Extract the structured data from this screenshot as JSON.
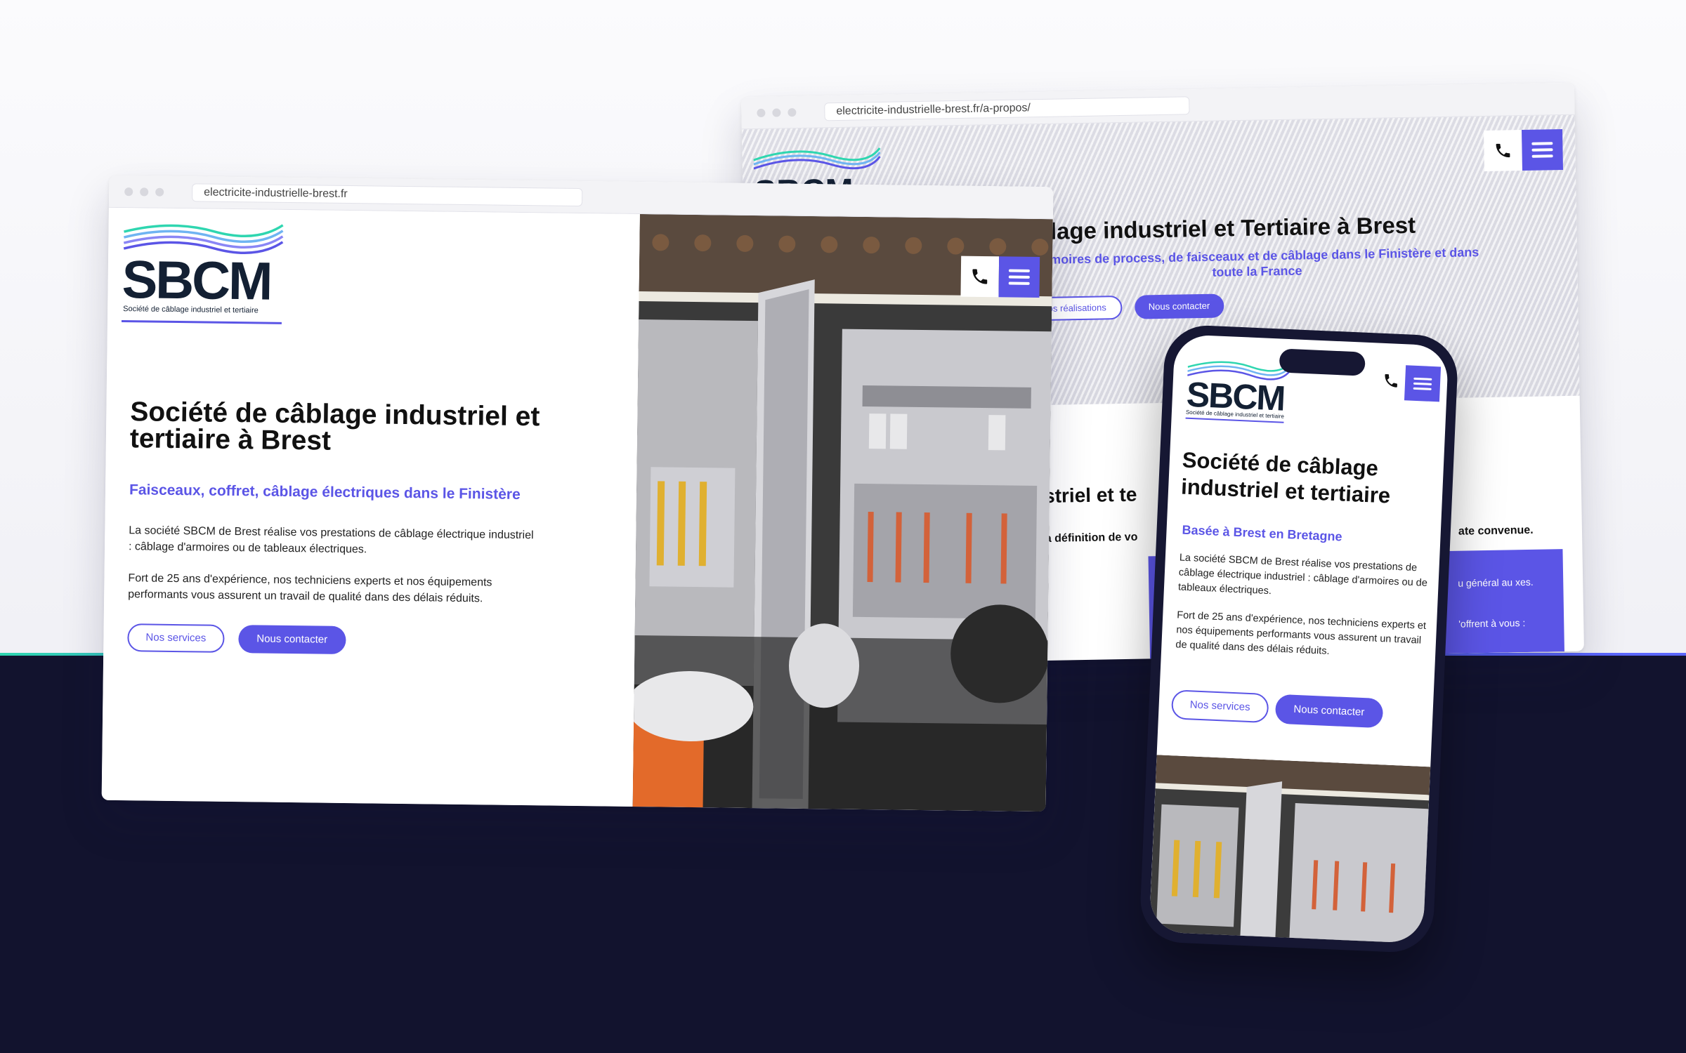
{
  "brand": {
    "logo_text": "SBCM",
    "tagline": "Société de câblage industriel et tertiaire",
    "accent": "#5b55e6",
    "dark": "#12132e",
    "teal": "#2fd6b0"
  },
  "back_window": {
    "url": "electricite-industrielle-brest.fr/a-propos/",
    "hero_title": "âblage industriel et Tertiaire à Brest",
    "hero_subtitle": "'armoires de process, de faisceaux et de câblage dans le Finistère et dans toute la France",
    "btn_realisations": "Nos réalisations",
    "btn_contact": "Nous contacter",
    "section_title": "ustriel et te",
    "section_text_a": "e la définition de vo",
    "section_text_b": "ate convenue.",
    "box_text_1": "u général au xes.",
    "box_text_2": "'offrent à vous :"
  },
  "main_window": {
    "url": "electricite-industrielle-brest.fr",
    "title": "Société de câblage industriel et tertiaire à Brest",
    "subtitle": "Faisceaux, coffret, câblage électriques dans le Finistère",
    "paragraph_1": "La société SBCM de Brest réalise vos prestations de câblage électrique industriel : câblage d'armoires ou de tableaux électriques.",
    "paragraph_2": "Fort de 25 ans d'expérience, nos techniciens experts et nos équipements performants vous assurent un travail de qualité dans des délais réduits.",
    "btn_services": "Nos services",
    "btn_contact": "Nous contacter"
  },
  "phone": {
    "title": "Société de câblage industriel et tertiaire",
    "subtitle": "Basée à Brest en Bretagne",
    "paragraph_1": "La société SBCM de Brest réalise vos prestations de câblage électrique industriel : câblage d'armoires ou de tableaux électriques.",
    "paragraph_2": "Fort de 25 ans d'expérience, nos techniciens experts et nos équipements performants vous assurent un travail de qualité dans des délais réduits.",
    "btn_services": "Nos services",
    "btn_contact": "Nous contacter"
  },
  "icons": {
    "phone": "phone-icon",
    "menu": "hamburger-menu-icon",
    "photo": "electrical-cabinet-photo"
  }
}
